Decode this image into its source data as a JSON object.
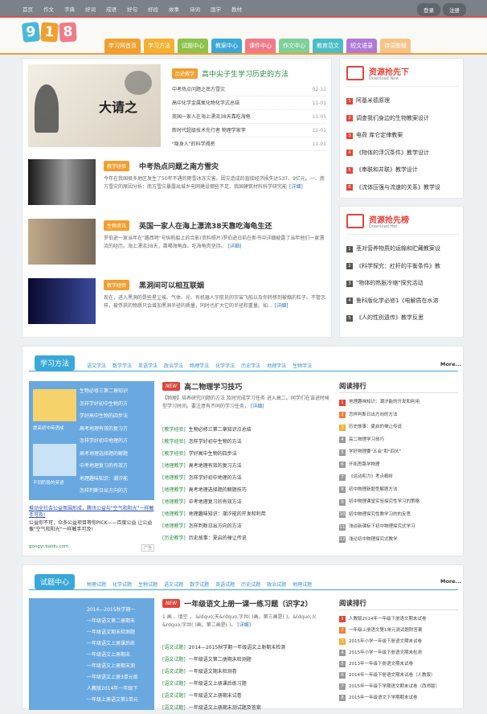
{
  "topnav": [
    "首页",
    "作文",
    "字典",
    "好词",
    "成语",
    "好句",
    "好段",
    "故事",
    "诗词",
    "国学",
    "教材"
  ],
  "login": {
    "login": "登录",
    "register": "注册"
  },
  "logo": [
    "9",
    "1",
    "8"
  ],
  "mainnav": [
    {
      "label": "学习网首页",
      "color": "#f0a030"
    },
    {
      "label": "学习方法",
      "color": "#f4b030"
    },
    {
      "label": "试题中心",
      "color": "#8cc34a"
    },
    {
      "label": "教案中心",
      "color": "#3aa8d8"
    },
    {
      "label": "课件中心",
      "color": "#f07a8a"
    },
    {
      "label": "作文中心",
      "color": "#7ecf9a"
    },
    {
      "label": "教育范文",
      "color": "#4abdc8"
    },
    {
      "label": "短文语录",
      "color": "#b07ad8"
    },
    {
      "label": "诗词歌赋",
      "color": "#f6c48a"
    }
  ],
  "featured": {
    "tag": "历史教学",
    "title": "高中尖子生学习历史的方法",
    "image_text": "大请之",
    "items": [
      {
        "t": "中考热点问题之南方雪灾",
        "d": "02-11"
      },
      {
        "t": "高中化学金属氧化物化学式总结",
        "d": "11-01"
      },
      {
        "t": "英国一家人在海上漂流38天靠吃海龟",
        "d": "11-05"
      },
      {
        "t": "新时代超级技术先行者 物理学家李",
        "d": "11-01"
      },
      {
        "t": "\"隐身人\"的科学揭密",
        "d": "11-01"
      }
    ]
  },
  "articles": [
    {
      "tag": "教学经验",
      "tagcolor": "#f0a030",
      "title": "中考热点问题之南方雪灾",
      "text": "今年在我国很多地区发生了50年不遇的雨雪冰冻灾害。因灾造成的直接经济损失达537．9亿元。一、南方雪灾的原因分析：南方雪灾暴露出城乡电网建设哪些不足，我国建筑材料科学研究能",
      "link": "[详细]"
    },
    {
      "tag": "生物资讯",
      "tagcolor": "#f0a030",
      "title": "英国一家人在海上漂流38天靠吃海龟生还",
      "text": "罗伯逊一家当年在\"路西特\"号纵帆船上的合影(资料照片)罗伯逊日前在新书中详细披露了当年他们一家漂流的经历。海上漂流38天，靠喝海龟血、吃海龟肉坚持。",
      "link": "[详细]"
    },
    {
      "tag": "教学经验",
      "tagcolor": "#f0a030",
      "title": "黑洞间可以相互联姻",
      "text": "现在，进入黑洞的是些星尘埃、气体、光、有机器人宇航员的宇宙飞船以及你转移到被缩的粒子。不管怎样，被俘获的物质只会增加黑洞半径的质量，同时也扩大它的半径和重量。如...",
      "link": "[详细]"
    }
  ],
  "res_new": {
    "title": "资源抢先下",
    "sub": "Download New",
    "items": [
      "阿基米德原理",
      "调查我们身边的生物教案设计",
      "电荷 库仑定律教案",
      "《物体的浮沉条件》教学设计",
      "《串联和并联》教学设计",
      "《流体压强与流速的关系》教学设"
    ]
  },
  "res_hot": {
    "title": "资源抢先榜",
    "sub": "Download Hot",
    "items": [
      "茎对营养物质的运输和贮藏教案设",
      "《科学探究：杠杆的平衡条件》教",
      "\"物体的热胀冷缩\"探究活动",
      "鲁科版化学必修1《电解质在水溶",
      "《人的性别遗传》教学反思"
    ]
  },
  "study": {
    "head": "学习方法",
    "subnav": [
      "语文学法",
      "数学学法",
      "英语学法",
      "政治学法",
      "物理学法",
      "化学学法",
      "历史学法",
      "地理学法",
      "生物学法"
    ],
    "more": "More...",
    "left_items": [
      "生物必修三第二章知识",
      "怎样学好初中生物的方",
      "学好高中生物的四步法",
      "高考地理有效的复习方",
      "怎样学好初中地理的方",
      "高考地理选择题的解题",
      "中考地理复习的有效方",
      "地理趣味知识：潮汐能",
      "怎样判断日出方向的方"
    ],
    "img1": "提高初中英语成",
    "img2": "不同阶段的英语",
    "ad_title": "推动全社会公益氛围形成，腾讯公益与\"空气和阳光\"一样触手可及!",
    "ad_text": "公益你不可，众多公益项目等你PICK——百度公益 让公益像\"空气和阳光\"一样触手可及!",
    "ad_url": "gongyi.baidu.com",
    "ad_badge": "广告",
    "new_badge": "NEW",
    "top_title": "高二物理学习技巧",
    "top_text": "【物理】培养研究问题的方法 及时完成学习任务 进入高二。同学们在该进时候型学习时间。要注意有不同的学习任务，",
    "top_link": "[详细]",
    "list": [
      {
        "c": "[教学经验]",
        "t": "生物必修三第二章知识点总结"
      },
      {
        "c": "[教学经验]",
        "t": "怎样学好初中生物的方法"
      },
      {
        "c": "[教学经验]",
        "t": "学好高中生物的四步法"
      },
      {
        "c": "[地理教学]",
        "t": "高考地理有效的复习方法"
      },
      {
        "c": "[地理教学]",
        "t": "怎样学好初中地理的方法"
      },
      {
        "c": "[地理教学]",
        "t": "高考地理选择题的解题技巧"
      },
      {
        "c": "[地理教学]",
        "t": "中考地理复习的有效方法"
      },
      {
        "c": "[地理教学]",
        "t": "地理趣味知识：潮汐能的开发和利用"
      },
      {
        "c": "[地理教学]",
        "t": "怎样判断日出方向的方法"
      },
      {
        "c": "[历史教学]",
        "t": "历史故事：夏启的禅让传说"
      }
    ],
    "rank_title": "阅读排行",
    "rank": [
      "地理趣味知识：潮汐能的开发和利用",
      "怎样判断日出方向的方法",
      "历史故事：夏启的禅让传说",
      "高二物理学习技巧",
      "学好物理要\"五会\"和\"四头\"",
      "开拓思路学物理",
      "《运动和力》考点精析",
      "初中物理新题型解题方法",
      "初中物理课堂实验探究性学习的策略",
      "初中物理探究性教学习的的反思",
      "浅谈新课标下初中物理探究式学习",
      "浅论初中物理探究式教学"
    ]
  },
  "exam": {
    "head": "试题中心",
    "subnav": [
      "物理试题",
      "化学试题",
      "生物试题",
      "语文试题",
      "数学试题",
      "英语试题",
      "历史试题",
      "政治试题",
      "地理试题"
    ],
    "more": "More...",
    "left_items": [
      "2014—2015秋学期一",
      "一年级语文第二册期末",
      "一年级语文期末检测题",
      "一年级语文上册课后练",
      "一年级语文上册期末",
      "一年级语文上册期末测",
      "一年级语文上册3单元练",
      "人教版2014年一年级下",
      "一年级上册语文第1单元"
    ],
    "new_badge": "NEW",
    "top_title": "一年级语文上册一课一练习题（识字2）",
    "top_text": "1 画   、填空 ，  &ldquo;天&rdquo;字共(   )画，第三画是(   )。&ldquo;火&rdquo;字共(   )画，第二画是(   )。",
    "top_link": "[详细]",
    "list": [
      {
        "c": "[语文试题]",
        "t": "2014—2015秋学期一年级语文上册期末检测"
      },
      {
        "c": "[语文试题]",
        "t": "一年级语文第二册期末检测题"
      },
      {
        "c": "[语文试题]",
        "t": "一年级语文期末检测卷"
      },
      {
        "c": "[语文试题]",
        "t": "一年级语文上册课后练习题"
      },
      {
        "c": "[语文试题]",
        "t": "一年级语文上册期末试卷"
      },
      {
        "c": "[语文试题]",
        "t": "一年级语文上册期末测试题及答案"
      }
    ],
    "rank_title": "阅读排行",
    "rank": [
      "人教版2014年一年级下册语文期末试卷",
      "一年级上册语文第1单元测试题附答案",
      "2015年小学一年级下册语文期末试卷",
      "2015年小学一年级下册语文期末检测",
      "2013年一年级下册语文期末试卷",
      "2014年一年级下册语文期末试卷（人教版）",
      "2015年一年级下学期语文期末试卷（西师版）",
      "2015年一年级语文下学期期末试卷"
    ]
  },
  "colors": {
    "rank1": "#e0463c",
    "rank2": "#f08030",
    "rank3": "#f0b030",
    "rankn": "#999999",
    "blue": "#3a8fd0"
  }
}
